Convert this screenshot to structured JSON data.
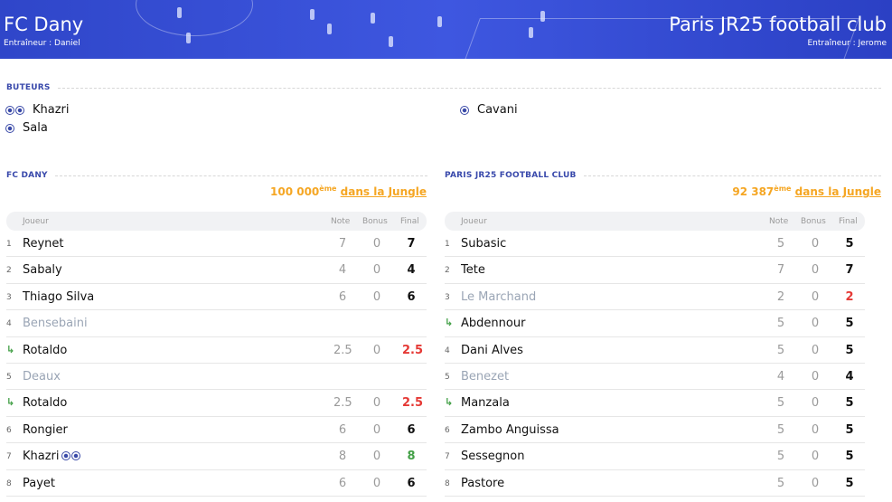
{
  "header": {
    "home": {
      "name": "FC Dany",
      "coach": "Entraîneur : Daniel"
    },
    "away": {
      "name": "Paris JR25 football club",
      "coach": "Entraîneur : Jerome"
    }
  },
  "scorers": {
    "title": "BUTEURS",
    "home": [
      {
        "name": "Khazri",
        "goals": 2
      },
      {
        "name": "Sala",
        "goals": 1
      }
    ],
    "away": [
      {
        "name": "Cavani",
        "goals": 1
      }
    ]
  },
  "teams": {
    "home": {
      "title": "FC DANY",
      "rank_number": "100 000",
      "rank_suffix": "ème",
      "rank_link": "dans la Jungle",
      "columns": {
        "player": "Joueur",
        "note": "Note",
        "bonus": "Bonus",
        "final": "Final"
      },
      "rows": [
        {
          "num": "1",
          "name": "Reynet",
          "note": "7",
          "bonus": "0",
          "final": "7",
          "status": "normal"
        },
        {
          "num": "2",
          "name": "Sabaly",
          "note": "4",
          "bonus": "0",
          "final": "4",
          "status": "normal"
        },
        {
          "num": "3",
          "name": "Thiago Silva",
          "note": "6",
          "bonus": "0",
          "final": "6",
          "status": "normal"
        },
        {
          "num": "4",
          "name": "Bensebaini",
          "note": "",
          "bonus": "",
          "final": "",
          "status": "bench"
        },
        {
          "num": "",
          "name": "Rotaldo",
          "note": "2.5",
          "bonus": "0",
          "final": "2.5",
          "status": "sub",
          "final_color": "red"
        },
        {
          "num": "5",
          "name": "Deaux",
          "note": "",
          "bonus": "",
          "final": "",
          "status": "bench"
        },
        {
          "num": "",
          "name": "Rotaldo",
          "note": "2.5",
          "bonus": "0",
          "final": "2.5",
          "status": "sub",
          "final_color": "red"
        },
        {
          "num": "6",
          "name": "Rongier",
          "note": "6",
          "bonus": "0",
          "final": "6",
          "status": "normal"
        },
        {
          "num": "7",
          "name": "Khazri",
          "note": "8",
          "bonus": "0",
          "final": "8",
          "status": "normal",
          "goals": 2,
          "final_color": "green"
        },
        {
          "num": "8",
          "name": "Payet",
          "note": "6",
          "bonus": "0",
          "final": "6",
          "status": "normal"
        }
      ]
    },
    "away": {
      "title": "PARIS JR25 FOOTBALL CLUB",
      "rank_number": "92 387",
      "rank_suffix": "ème",
      "rank_link": "dans la Jungle",
      "columns": {
        "player": "Joueur",
        "note": "Note",
        "bonus": "Bonus",
        "final": "Final"
      },
      "rows": [
        {
          "num": "1",
          "name": "Subasic",
          "note": "5",
          "bonus": "0",
          "final": "5",
          "status": "normal"
        },
        {
          "num": "2",
          "name": "Tete",
          "note": "7",
          "bonus": "0",
          "final": "7",
          "status": "normal"
        },
        {
          "num": "3",
          "name": "Le Marchand",
          "note": "2",
          "bonus": "0",
          "final": "2",
          "status": "bench",
          "final_color": "red"
        },
        {
          "num": "",
          "name": "Abdennour",
          "note": "5",
          "bonus": "0",
          "final": "5",
          "status": "sub"
        },
        {
          "num": "4",
          "name": "Dani Alves",
          "note": "5",
          "bonus": "0",
          "final": "5",
          "status": "normal"
        },
        {
          "num": "5",
          "name": "Benezet",
          "note": "4",
          "bonus": "0",
          "final": "4",
          "status": "bench"
        },
        {
          "num": "",
          "name": "Manzala",
          "note": "5",
          "bonus": "0",
          "final": "5",
          "status": "sub"
        },
        {
          "num": "6",
          "name": "Zambo Anguissa",
          "note": "5",
          "bonus": "0",
          "final": "5",
          "status": "normal"
        },
        {
          "num": "7",
          "name": "Sessegnon",
          "note": "5",
          "bonus": "0",
          "final": "5",
          "status": "normal"
        },
        {
          "num": "8",
          "name": "Pastore",
          "note": "5",
          "bonus": "0",
          "final": "5",
          "status": "normal"
        }
      ]
    }
  },
  "colors": {
    "header_blue": "#3e57e0",
    "title_blue": "#3949ab",
    "rank_orange": "#f5a623",
    "sub_green": "#43a047",
    "low_red": "#e53935"
  },
  "icons": {
    "goal": "soccer-ball-icon",
    "substitution": "substitution-arrow-icon"
  }
}
